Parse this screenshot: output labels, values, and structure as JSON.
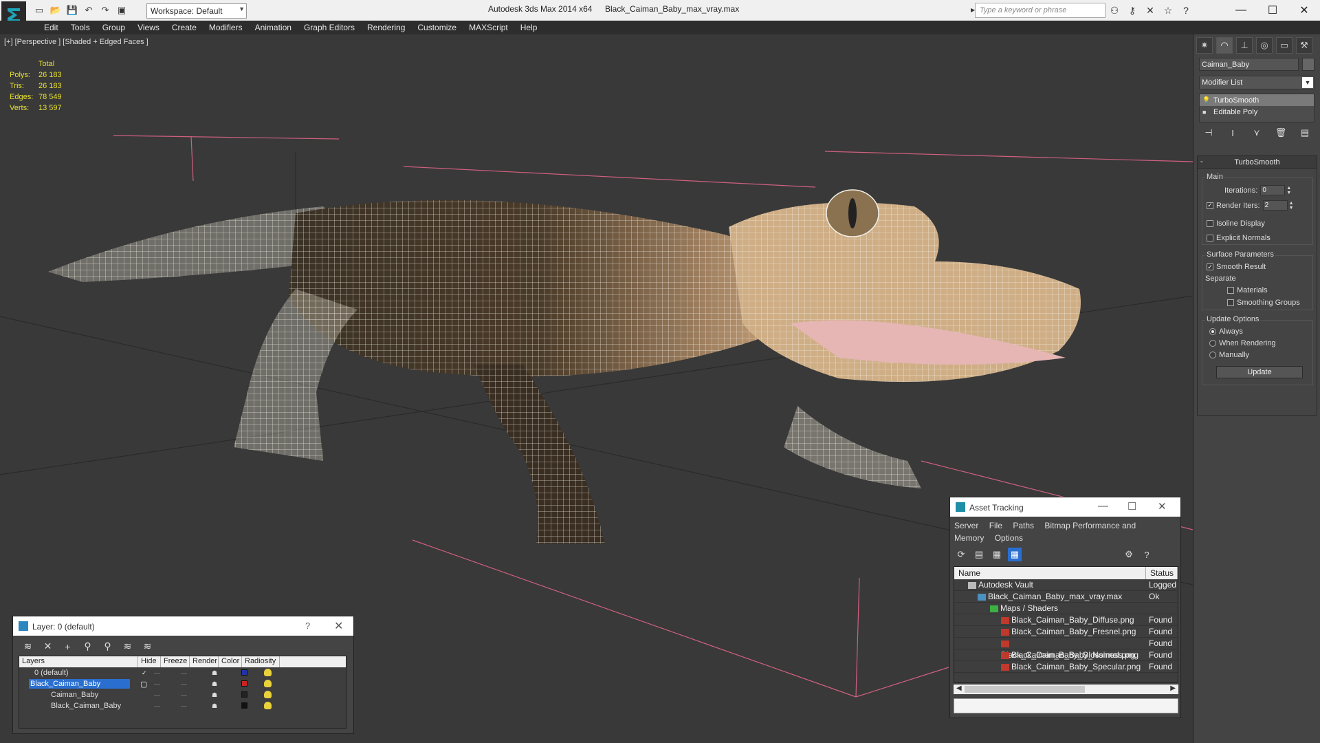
{
  "titlebar": {
    "app_title": "Autodesk 3ds Max  2014 x64",
    "file_name": "Black_Caiman_Baby_max_vray.max",
    "workspace": "Workspace: Default",
    "search_placeholder": "Type a keyword or phrase",
    "icons": [
      "new-icon",
      "open-icon",
      "save-icon",
      "undo-icon",
      "redo-icon",
      "project-icon"
    ],
    "tool_icons": [
      "binoculars-icon",
      "key-icon",
      "exchange-icon",
      "star-icon",
      "help-icon"
    ]
  },
  "menu": [
    "Edit",
    "Tools",
    "Group",
    "Views",
    "Create",
    "Modifiers",
    "Animation",
    "Graph Editors",
    "Rendering",
    "Customize",
    "MAXScript",
    "Help"
  ],
  "viewport": {
    "label": "[+] [Perspective ] [Shaded + Edged Faces ]",
    "stats": {
      "header": "Total",
      "rows": [
        {
          "k": "Polys:",
          "v": "26 183"
        },
        {
          "k": "Tris:",
          "v": "26 183"
        },
        {
          "k": "Edges:",
          "v": "78 549"
        },
        {
          "k": "Verts:",
          "v": "13 597"
        }
      ]
    }
  },
  "command_panel": {
    "tabs": [
      "create-icon",
      "modify-icon",
      "hierarchy-icon",
      "motion-icon",
      "display-icon",
      "utilities-icon"
    ],
    "object_name": "Caiman_Baby",
    "modifier_list": "Modifier List",
    "stack": [
      "TurboSmooth",
      "Editable Poly"
    ],
    "rollout_title": "TurboSmooth",
    "main_group": "Main",
    "iterations_label": "Iterations:",
    "iterations_value": "0",
    "render_iters_label": "Render Iters:",
    "render_iters_value": "2",
    "isoline_label": "Isoline Display",
    "explicit_label": "Explicit Normals",
    "surface_group": "Surface Parameters",
    "smooth_result_label": "Smooth Result",
    "separate_label": "Separate",
    "materials_label": "Materials",
    "smoothing_groups_label": "Smoothing Groups",
    "update_group": "Update Options",
    "always_label": "Always",
    "when_rendering_label": "When Rendering",
    "manually_label": "Manually",
    "update_button": "Update"
  },
  "layer_dialog": {
    "title": "Layer: 0 (default)",
    "help": "?",
    "columns": [
      "Layers",
      "Hide",
      "Freeze",
      "Render",
      "Color",
      "Radiosity"
    ],
    "rows": [
      {
        "name": "0 (default)",
        "color": "#2233aa"
      },
      {
        "name": "Black_Caiman_Baby",
        "color": "#cc2222"
      },
      {
        "name": "Caiman_Baby",
        "color": "#222222"
      },
      {
        "name": "Black_Caiman_Baby",
        "color": "#111111"
      }
    ]
  },
  "asset_dialog": {
    "title": "Asset Tracking",
    "menu": [
      "Server",
      "File",
      "Paths",
      "Bitmap Performance and Memory",
      "Options"
    ],
    "columns": [
      "Name",
      "Status"
    ],
    "rows": [
      {
        "name": "Autodesk Vault",
        "status": "Logged"
      },
      {
        "name": "Black_Caiman_Baby_max_vray.max",
        "status": "Ok"
      },
      {
        "name": "Maps / Shaders",
        "status": ""
      },
      {
        "name": "Black_Caiman_Baby_Diffuse.png",
        "status": "Found"
      },
      {
        "name": "Black_Caiman_Baby_Fresnel.png",
        "status": "Found"
      },
      {
        "name": "Black_Caiman_Baby_Glossiness.png",
        "status": "Found"
      },
      {
        "name": "Black_Caiman_Baby_Normal.png",
        "status": "Found"
      },
      {
        "name": "Black_Caiman_Baby_Specular.png",
        "status": "Found"
      }
    ]
  }
}
